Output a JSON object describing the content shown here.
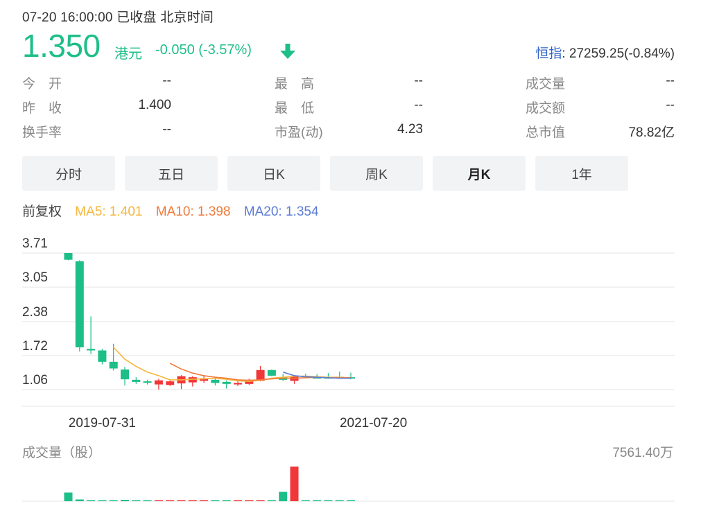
{
  "header": {
    "status": "07-20 16:00:00  已收盘  北京时间",
    "price": "1.350",
    "currency": "港元",
    "change": "-0.050 (-3.57%)",
    "index_name": "恒指",
    "index_value": ": 27259.25(-0.84%)"
  },
  "stats": [
    {
      "label": "今　开",
      "value": "--"
    },
    {
      "label": "最　高",
      "value": "--"
    },
    {
      "label": "成交量",
      "value": "--"
    },
    {
      "label": "昨　收",
      "value": "1.400"
    },
    {
      "label": "最　低",
      "value": "--"
    },
    {
      "label": "成交额",
      "value": "--"
    },
    {
      "label": "换手率",
      "value": "--"
    },
    {
      "label": "市盈(动)",
      "value": "4.23"
    },
    {
      "label": "总市值",
      "value": "78.82亿"
    }
  ],
  "tabs": [
    {
      "label": "分时",
      "active": false
    },
    {
      "label": "五日",
      "active": false
    },
    {
      "label": "日K",
      "active": false
    },
    {
      "label": "周K",
      "active": false
    },
    {
      "label": "月K",
      "active": true
    },
    {
      "label": "1年",
      "active": false
    }
  ],
  "ma": {
    "adjust": "前复权",
    "ma5": "MA5: 1.401",
    "ma10": "MA10: 1.398",
    "ma20": "MA20: 1.354"
  },
  "volume": {
    "title": "成交量（股）",
    "max": "7561.40万"
  },
  "colors": {
    "up": "#f0373a",
    "down": "#1dbf87",
    "ma5": "#f5b73b",
    "ma10": "#f27a3a",
    "ma20": "#5b7bd6",
    "grid": "#e6e6e6",
    "index_link": "#2f62c6"
  },
  "chart_data": {
    "type": "candlestick",
    "period": "monthly",
    "y_ticks": [
      "3.71",
      "3.05",
      "2.38",
      "1.72",
      "1.06"
    ],
    "ylim": [
      1.06,
      3.71
    ],
    "x_labels": [
      {
        "label": "2019-07-31",
        "index": 3
      },
      {
        "label": "2021-07-20",
        "index": 27
      }
    ],
    "candles": [
      {
        "o": 3.71,
        "c": 3.58,
        "h": 3.71,
        "l": 3.57
      },
      {
        "o": 3.55,
        "c": 1.88,
        "h": 3.57,
        "l": 1.8
      },
      {
        "o": 1.85,
        "c": 1.82,
        "h": 2.48,
        "l": 1.75
      },
      {
        "o": 1.82,
        "c": 1.6,
        "h": 1.85,
        "l": 1.55
      },
      {
        "o": 1.6,
        "c": 1.47,
        "h": 1.95,
        "l": 1.43
      },
      {
        "o": 1.45,
        "c": 1.26,
        "h": 1.5,
        "l": 1.14
      },
      {
        "o": 1.25,
        "c": 1.21,
        "h": 1.3,
        "l": 1.17
      },
      {
        "o": 1.22,
        "c": 1.2,
        "h": 1.25,
        "l": 1.16
      },
      {
        "o": 1.16,
        "c": 1.24,
        "h": 1.27,
        "l": 1.06
      },
      {
        "o": 1.15,
        "c": 1.22,
        "h": 1.26,
        "l": 1.13
      },
      {
        "o": 1.18,
        "c": 1.32,
        "h": 1.34,
        "l": 1.07
      },
      {
        "o": 1.2,
        "c": 1.3,
        "h": 1.32,
        "l": 1.12
      },
      {
        "o": 1.23,
        "c": 1.28,
        "h": 1.34,
        "l": 1.19
      },
      {
        "o": 1.25,
        "c": 1.19,
        "h": 1.3,
        "l": 1.14
      },
      {
        "o": 1.21,
        "c": 1.17,
        "h": 1.24,
        "l": 1.08
      },
      {
        "o": 1.16,
        "c": 1.19,
        "h": 1.22,
        "l": 1.13
      },
      {
        "o": 1.17,
        "c": 1.25,
        "h": 1.27,
        "l": 1.15
      },
      {
        "o": 1.23,
        "c": 1.44,
        "h": 1.52,
        "l": 1.22
      },
      {
        "o": 1.44,
        "c": 1.33,
        "h": 1.45,
        "l": 1.32
      },
      {
        "o": 1.3,
        "c": 1.25,
        "h": 1.37,
        "l": 1.23
      },
      {
        "o": 1.23,
        "c": 1.31,
        "h": 1.34,
        "l": 1.17
      },
      {
        "o": 1.33,
        "c": 1.3,
        "h": 1.37,
        "l": 1.29
      },
      {
        "o": 1.3,
        "c": 1.29,
        "h": 1.36,
        "l": 1.28
      },
      {
        "o": 1.3,
        "c": 1.28,
        "h": 1.38,
        "l": 1.27
      },
      {
        "o": 1.31,
        "c": 1.28,
        "h": 1.41,
        "l": 1.27
      },
      {
        "o": 1.3,
        "c": 1.28,
        "h": 1.39,
        "l": 1.26
      }
    ],
    "ma5": [
      null,
      null,
      null,
      null,
      1.88,
      1.65,
      1.51,
      1.4,
      1.33,
      1.25,
      1.25,
      1.26,
      1.27,
      1.28,
      1.26,
      1.23,
      1.22,
      1.24,
      1.28,
      1.3,
      1.32,
      1.32,
      1.31,
      1.3,
      1.3,
      1.29
    ],
    "ma10": [
      null,
      null,
      null,
      null,
      null,
      null,
      null,
      null,
      null,
      1.57,
      1.46,
      1.38,
      1.33,
      1.3,
      1.28,
      1.25,
      1.24,
      1.25,
      1.27,
      1.28,
      1.28,
      1.29,
      1.3,
      1.29,
      1.29,
      1.29
    ],
    "ma20": [
      null,
      null,
      null,
      null,
      null,
      null,
      null,
      null,
      null,
      null,
      null,
      null,
      null,
      null,
      null,
      null,
      null,
      null,
      null,
      1.4,
      1.33,
      1.31,
      1.3,
      1.29,
      1.28,
      1.28
    ],
    "volume_max_label": "7561.40万",
    "volume": [
      0.25,
      0.05,
      0.03,
      0.03,
      0.03,
      0.04,
      0.03,
      0.02,
      0.02,
      0.02,
      0.02,
      0.02,
      0.02,
      0.02,
      0.02,
      0.02,
      0.02,
      0.02,
      0.02,
      0.27,
      1.0,
      0.02,
      0.02,
      0.02,
      0.02,
      0.02
    ]
  }
}
